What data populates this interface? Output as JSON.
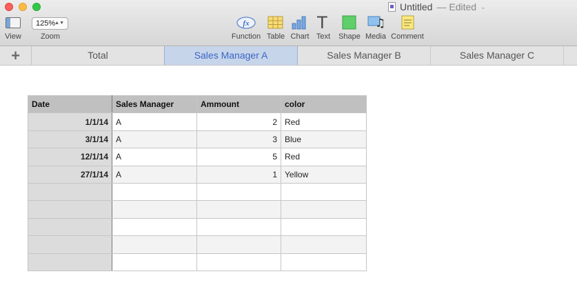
{
  "window": {
    "title": "Untitled",
    "status": "— Edited",
    "chevron": "⌄"
  },
  "toolbar": {
    "view_label": "View",
    "zoom_value": "125%",
    "zoom_arrows": "▲▼",
    "zoom_label": "Zoom",
    "function_icon_text": "fx",
    "function_label": "Function",
    "table_label": "Table",
    "chart_label": "Chart",
    "text_label": "Text",
    "shape_label": "Shape",
    "media_label": "Media",
    "comment_label": "Comment",
    "text_icon_glyph": "T",
    "media_icon_glyph": "♫"
  },
  "sheets": {
    "add_label": "+",
    "tabs": [
      {
        "label": "Total"
      },
      {
        "label": "Sales Manager A"
      },
      {
        "label": "Sales Manager B"
      },
      {
        "label": "Sales Manager C"
      }
    ]
  },
  "table": {
    "headers": [
      "Date",
      "Sales Manager",
      "Ammount",
      "color"
    ],
    "rows": [
      [
        "1/1/14",
        "A",
        "2",
        "Red"
      ],
      [
        "3/1/14",
        "A",
        "3",
        "Blue"
      ],
      [
        "12/1/14",
        "A",
        "5",
        "Red"
      ],
      [
        "27/1/14",
        "A",
        "1",
        "Yellow"
      ],
      [
        "",
        "",
        "",
        ""
      ],
      [
        "",
        "",
        "",
        ""
      ],
      [
        "",
        "",
        "",
        ""
      ],
      [
        "",
        "",
        "",
        ""
      ],
      [
        "",
        "",
        "",
        ""
      ]
    ]
  },
  "colors": {
    "active_tab_bg": "#c7d5ea",
    "active_tab_text": "#3a66c4",
    "header_bg": "#c0c0c0"
  }
}
